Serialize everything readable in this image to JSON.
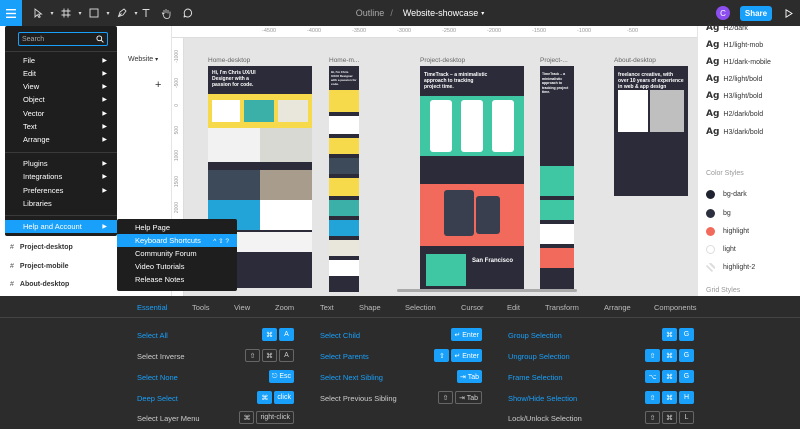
{
  "toolbar": {
    "project": "Outline",
    "file": "Website-showcase",
    "avatar_letter": "C",
    "share_label": "Share"
  },
  "left_panel": {
    "page_select": "Website",
    "layers": [
      "Project-desktop",
      "Project-mobile",
      "About-desktop"
    ]
  },
  "main_menu": {
    "search_placeholder": "Search",
    "items": [
      {
        "label": "File",
        "submenu": true
      },
      {
        "label": "Edit",
        "submenu": true
      },
      {
        "label": "View",
        "submenu": true
      },
      {
        "label": "Object",
        "submenu": true
      },
      {
        "label": "Vector",
        "submenu": true
      },
      {
        "label": "Text",
        "submenu": true
      },
      {
        "label": "Arrange",
        "submenu": true
      },
      {
        "label": "Plugins",
        "submenu": true
      },
      {
        "label": "Integrations",
        "submenu": true
      },
      {
        "label": "Preferences",
        "submenu": true
      },
      {
        "label": "Libraries",
        "submenu": false
      },
      {
        "label": "Help and Account",
        "submenu": true
      }
    ]
  },
  "help_submenu": {
    "items": [
      {
        "label": "Help Page",
        "shortcut": ""
      },
      {
        "label": "Keyboard Shortcuts",
        "shortcut": "^ ⇧ ?"
      },
      {
        "label": "Community Forum",
        "shortcut": ""
      },
      {
        "label": "Video Tutorials",
        "shortcut": ""
      },
      {
        "label": "Release Notes",
        "shortcut": ""
      }
    ]
  },
  "canvas": {
    "ruler_ticks": [
      "-4500",
      "-4000",
      "-3500",
      "-3000",
      "-2500",
      "-2000",
      "-1500",
      "-1000",
      "-500"
    ],
    "vruler_ticks": [
      "-1000",
      "-500",
      "0",
      "500",
      "1000",
      "1500",
      "2000",
      "2500",
      "3000",
      "3500"
    ],
    "frames": [
      {
        "label": "Home-desktop",
        "text": "Hi, I'm Chris UX/UI Designer with a passion for code."
      },
      {
        "label": "Home-m...",
        "text": "Hi, I'm Chris UX/UI Designer with a passion for code."
      },
      {
        "label": "Project-desktop",
        "text": "TimeTrack – a minimalistic approach to tracking project time.",
        "text2": "San Francisco"
      },
      {
        "label": "Project-...",
        "text": "TimeTrack – a minimalistic approach to tracking project time."
      },
      {
        "label": "About-desktop",
        "text": "freelance creative, with over 10 years of experience in web & app design"
      }
    ]
  },
  "right_panel": {
    "text_styles": [
      "H2/dark",
      "H1/light-mob",
      "H1/dark-mobile",
      "H2/light/bold",
      "H3/light/bold",
      "H2/dark/bold",
      "H3/dark/bold"
    ],
    "text_style_glyph": "Ag",
    "color_styles_title": "Color Styles",
    "color_styles": [
      {
        "name": "bg-dark",
        "color": "#1f2330"
      },
      {
        "name": "bg",
        "color": "#2b2f3e"
      },
      {
        "name": "highlight",
        "color": "#f26a5b"
      },
      {
        "name": "light",
        "color": "#ffffff"
      },
      {
        "name": "highlight-2",
        "color": "#e0e0e0"
      }
    ],
    "grid_styles_title": "Grid Styles"
  },
  "shortcuts": {
    "tabs": [
      "Essential",
      "Tools",
      "View",
      "Zoom",
      "Text",
      "Shape",
      "Selection",
      "Cursor",
      "Edit",
      "Transform",
      "Arrange",
      "Components"
    ],
    "active_tab": "Selection",
    "columns": [
      [
        {
          "label": "Select All",
          "blue": true,
          "keys": [
            {
              "k": "⌘",
              "b": true
            },
            {
              "k": "A",
              "b": true
            }
          ]
        },
        {
          "label": "Select Inverse",
          "blue": false,
          "keys": [
            {
              "k": "⇧",
              "b": false
            },
            {
              "k": "⌘",
              "b": false
            },
            {
              "k": "A",
              "b": false
            }
          ]
        },
        {
          "label": "Select None",
          "blue": true,
          "keys": [
            {
              "k": "⎋ Esc",
              "b": true
            }
          ]
        },
        {
          "label": "Deep Select",
          "blue": true,
          "keys": [
            {
              "k": "⌘",
              "b": true
            },
            {
              "k": "click",
              "b": true
            }
          ]
        },
        {
          "label": "Select Layer Menu",
          "blue": false,
          "keys": [
            {
              "k": "⌘",
              "b": false
            },
            {
              "k": "right-click",
              "b": false
            }
          ]
        }
      ],
      [
        {
          "label": "Select Child",
          "blue": true,
          "keys": [
            {
              "k": "↵ Enter",
              "b": true
            }
          ]
        },
        {
          "label": "Select Parents",
          "blue": true,
          "keys": [
            {
              "k": "⇧",
              "b": true
            },
            {
              "k": "↵ Enter",
              "b": true
            }
          ]
        },
        {
          "label": "Select Next Sibling",
          "blue": true,
          "keys": [
            {
              "k": "⇥ Tab",
              "b": true
            }
          ]
        },
        {
          "label": "Select Previous Sibling",
          "blue": false,
          "keys": [
            {
              "k": "⇧",
              "b": false
            },
            {
              "k": "⇥ Tab",
              "b": false
            }
          ]
        }
      ],
      [
        {
          "label": "Group Selection",
          "blue": true,
          "keys": [
            {
              "k": "⌘",
              "b": true
            },
            {
              "k": "G",
              "b": true
            }
          ]
        },
        {
          "label": "Ungroup Selection",
          "blue": true,
          "keys": [
            {
              "k": "⇧",
              "b": true
            },
            {
              "k": "⌘",
              "b": true
            },
            {
              "k": "G",
              "b": true
            }
          ]
        },
        {
          "label": "Frame Selection",
          "blue": true,
          "keys": [
            {
              "k": "⌥",
              "b": true
            },
            {
              "k": "⌘",
              "b": true
            },
            {
              "k": "G",
              "b": true
            }
          ]
        },
        {
          "label": "Show/Hide Selection",
          "blue": true,
          "keys": [
            {
              "k": "⇧",
              "b": true
            },
            {
              "k": "⌘",
              "b": true
            },
            {
              "k": "H",
              "b": true
            }
          ]
        },
        {
          "label": "Lock/Unlock Selection",
          "blue": false,
          "keys": [
            {
              "k": "⇧",
              "b": false
            },
            {
              "k": "⌘",
              "b": false
            },
            {
              "k": "L",
              "b": false
            }
          ]
        }
      ]
    ]
  },
  "colors": {
    "accent": "#18a0fb",
    "toolbar": "#2c2c2c",
    "menu": "#1e1e1e"
  }
}
